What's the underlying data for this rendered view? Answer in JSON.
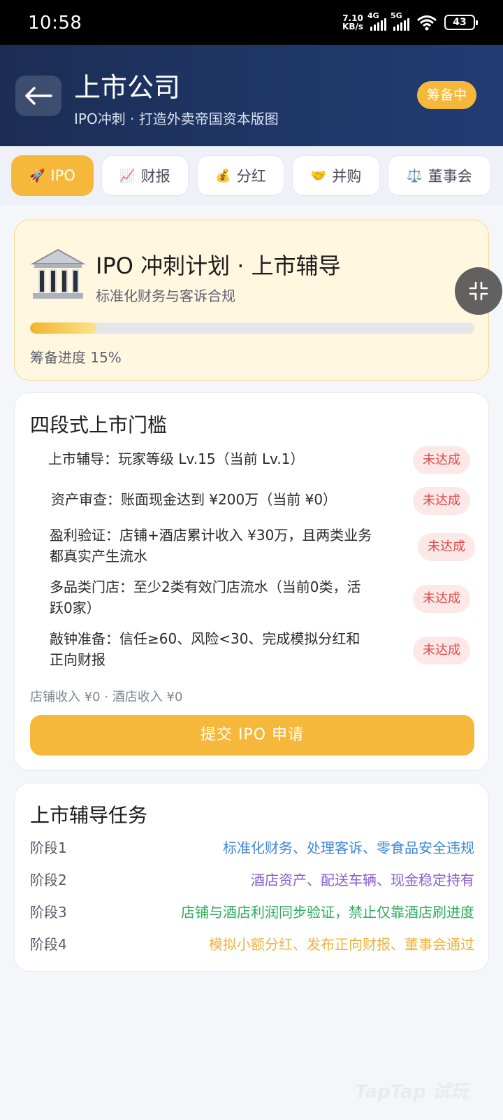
{
  "status_bar": {
    "time": "10:58",
    "net_speed_value": "7.10",
    "net_speed_unit": "KB/s",
    "signal_4g": "4G",
    "signal_5g": "5G",
    "battery": "43"
  },
  "header": {
    "title": "上市公司",
    "subtitle": "IPO冲刺 · 打造外卖帝国资本版图",
    "status_chip": "筹备中"
  },
  "tabs": [
    {
      "icon": "🚀",
      "label": "IPO",
      "active": true
    },
    {
      "icon": "📈",
      "label": "财报",
      "active": false
    },
    {
      "icon": "💰",
      "label": "分红",
      "active": false
    },
    {
      "icon": "🤝",
      "label": "并购",
      "active": false
    },
    {
      "icon": "⚖️",
      "label": "董事会",
      "active": false
    }
  ],
  "plan": {
    "title": "IPO 冲刺计划 · 上市辅导",
    "subtitle": "标准化财务与客诉合规",
    "progress_label": "筹备进度 15%",
    "progress_fraction": 0.15
  },
  "thresholds": {
    "title": "四段式上市门槛",
    "items": [
      {
        "text": "上市辅导：玩家等级 Lv.15（当前 Lv.1）",
        "status": "未达成"
      },
      {
        "text": "资产审查：账面现金达到 ¥200万（当前 ¥0）",
        "status": "未达成"
      },
      {
        "text_line1": "盈利验证：店铺+酒店累计收入 ¥30万，且两类业务",
        "text_line2": "都真实产生流水",
        "status": "未达成"
      },
      {
        "text_line1": "多品类门店：至少2类有效门店流水（当前0类，活",
        "text_line2": "跃0家）",
        "status": "未达成"
      },
      {
        "text_line1": "敲钟准备：信任≥60、风险<30、完成模拟分红和",
        "text_line2": "正向财报",
        "status": "未达成"
      }
    ],
    "income_line": "店铺收入 ¥0 · 酒店收入 ¥0",
    "submit_label": "提交 IPO 申请"
  },
  "tasks": {
    "title": "上市辅导任务",
    "rows": [
      {
        "stage": "阶段1",
        "desc": "标准化财务、处理客诉、零食品安全违规",
        "color": "#3f86d9"
      },
      {
        "stage": "阶段2",
        "desc": "酒店资产、配送车辆、现金稳定持有",
        "color": "#8a5fd0"
      },
      {
        "stage": "阶段3",
        "desc": "店铺与酒店利润同步验证，禁止仅靠酒店刷进度",
        "color": "#2fae5c"
      },
      {
        "stage": "阶段4",
        "desc": "模拟小额分红、发布正向财报、董事会通过",
        "color": "#f0b33a"
      }
    ]
  },
  "watermark": "TapTap 试玩",
  "colors": {
    "accent": "#f6b83b",
    "header_bg": "#1f3768",
    "badge_red": "#e04a4a"
  }
}
